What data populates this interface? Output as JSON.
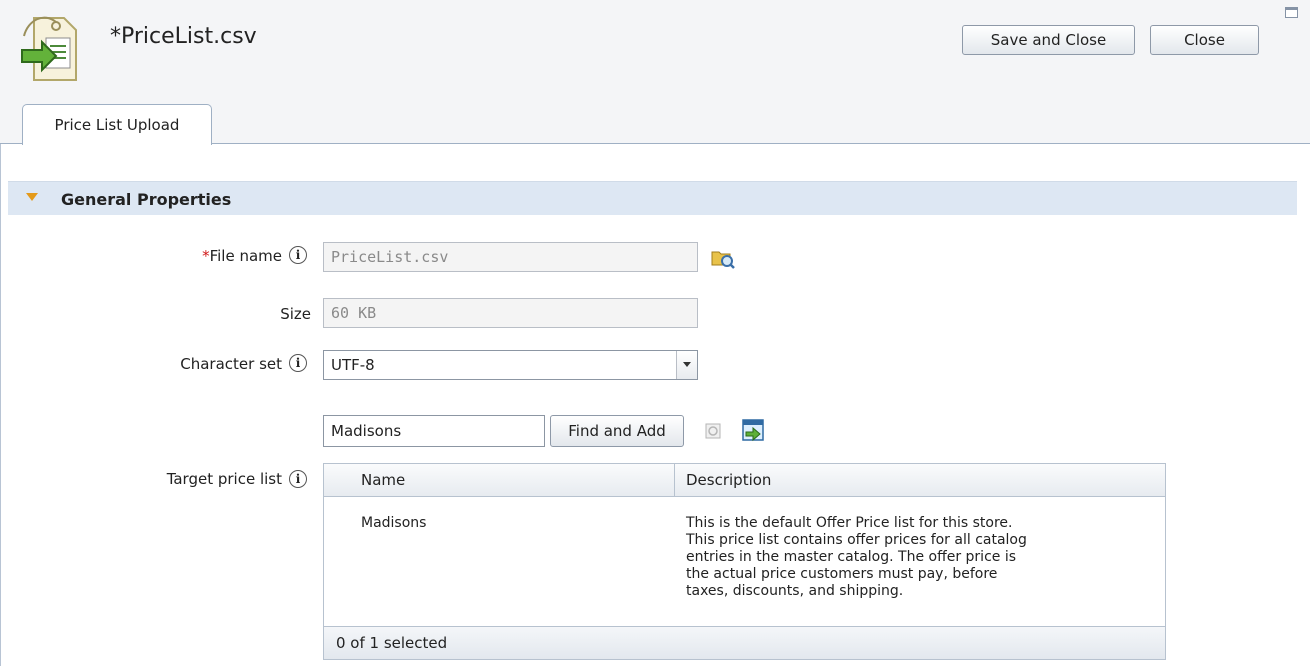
{
  "header": {
    "title": "*PriceList.csv",
    "save_and_close_label": "Save and Close",
    "close_label": "Close"
  },
  "tabs": [
    {
      "label": "Price List Upload",
      "active": true
    }
  ],
  "section": {
    "title": "General Properties",
    "expanded": true
  },
  "form": {
    "file_name": {
      "required_marker": "*",
      "label": "File name",
      "value": "PriceList.csv"
    },
    "size": {
      "label": "Size",
      "value": "60 KB"
    },
    "character_set": {
      "label": "Character set",
      "value": "UTF-8"
    },
    "search": {
      "value": "Madisons",
      "find_and_add_label": "Find and Add"
    },
    "target_price_list": {
      "label": "Target price list",
      "columns": [
        "Name",
        "Description"
      ],
      "rows": [
        {
          "name": "Madisons",
          "description_lines": [
            "This is the default Offer Price list for this store.",
            "This price list contains offer prices for all catalog",
            "entries in the master catalog. The offer price is",
            "the actual price customers must pay, before",
            "taxes, discounts, and shipping."
          ]
        }
      ],
      "footer": "0 of 1 selected"
    }
  },
  "colors": {
    "section_bg": "#dde7f3",
    "required": "#d01818",
    "arrow": "#e49a1a"
  }
}
